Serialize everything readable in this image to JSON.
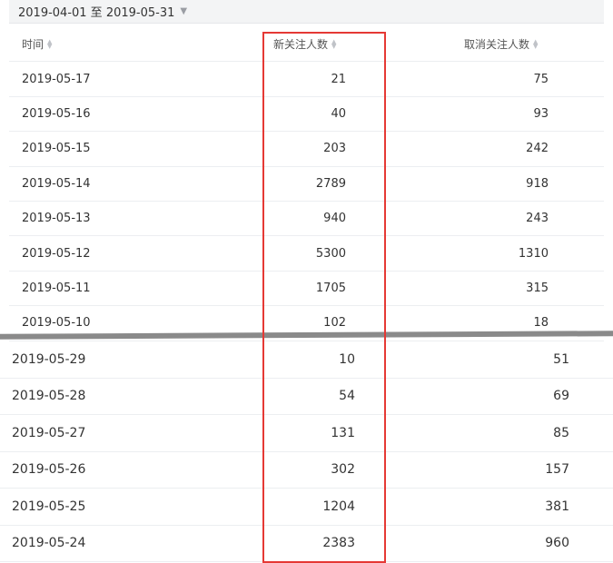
{
  "date_range": {
    "text": "2019-04-01 至 2019-05-31",
    "caret": "▼"
  },
  "headers": {
    "date": "时间",
    "new_followers": "新关注人数",
    "cancel_followers": "取消关注人数"
  },
  "top_rows": [
    {
      "date": "2019-05-17",
      "new": "21",
      "cancel": "75"
    },
    {
      "date": "2019-05-16",
      "new": "40",
      "cancel": "93"
    },
    {
      "date": "2019-05-15",
      "new": "203",
      "cancel": "242"
    },
    {
      "date": "2019-05-14",
      "new": "2789",
      "cancel": "918"
    },
    {
      "date": "2019-05-13",
      "new": "940",
      "cancel": "243"
    },
    {
      "date": "2019-05-12",
      "new": "5300",
      "cancel": "1310"
    },
    {
      "date": "2019-05-11",
      "new": "1705",
      "cancel": "315"
    },
    {
      "date": "2019-05-10",
      "new": "102",
      "cancel": "18"
    }
  ],
  "bottom_rows": [
    {
      "date": "2019-05-29",
      "new": "10",
      "cancel": "51"
    },
    {
      "date": "2019-05-28",
      "new": "54",
      "cancel": "69"
    },
    {
      "date": "2019-05-27",
      "new": "131",
      "cancel": "85"
    },
    {
      "date": "2019-05-26",
      "new": "302",
      "cancel": "157"
    },
    {
      "date": "2019-05-25",
      "new": "1204",
      "cancel": "381"
    },
    {
      "date": "2019-05-24",
      "new": "2383",
      "cancel": "960"
    }
  ],
  "colors": {
    "highlight": "#e53935",
    "divider": "#8a8a8a"
  }
}
